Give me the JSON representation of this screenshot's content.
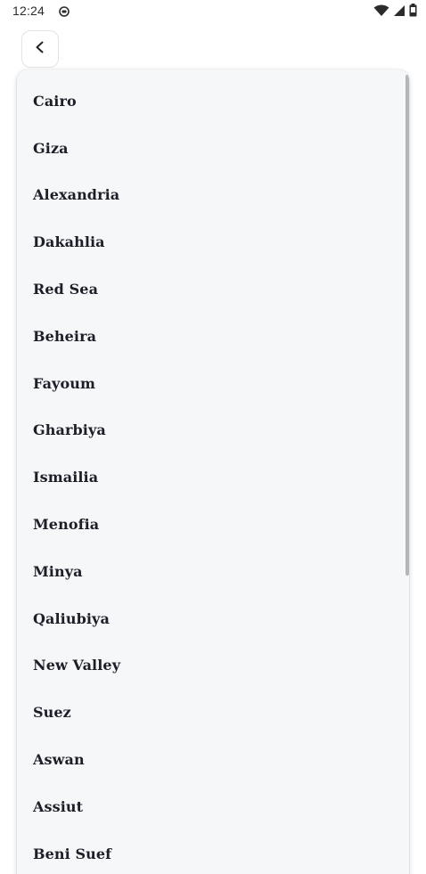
{
  "status_bar": {
    "time": "12:24",
    "app_icon": "app-notification-icon",
    "icons": [
      "wifi-icon",
      "cellular-signal-icon",
      "battery-icon"
    ]
  },
  "header": {
    "back_icon": "chevron-left-icon"
  },
  "dropdown": {
    "options": [
      "Cairo",
      "Giza",
      "Alexandria",
      "Dakahlia",
      "Red Sea",
      "Beheira",
      "Fayoum",
      "Gharbiya",
      "Ismailia",
      "Menofia",
      "Minya",
      "Qaliubiya",
      "New Valley",
      "Suez",
      "Aswan",
      "Assiut",
      "Beni Suef"
    ]
  },
  "colors": {
    "panel_background": "#f6f7f9",
    "option_text": "#1e1e28",
    "scrollbar": "#b5b6b8"
  }
}
